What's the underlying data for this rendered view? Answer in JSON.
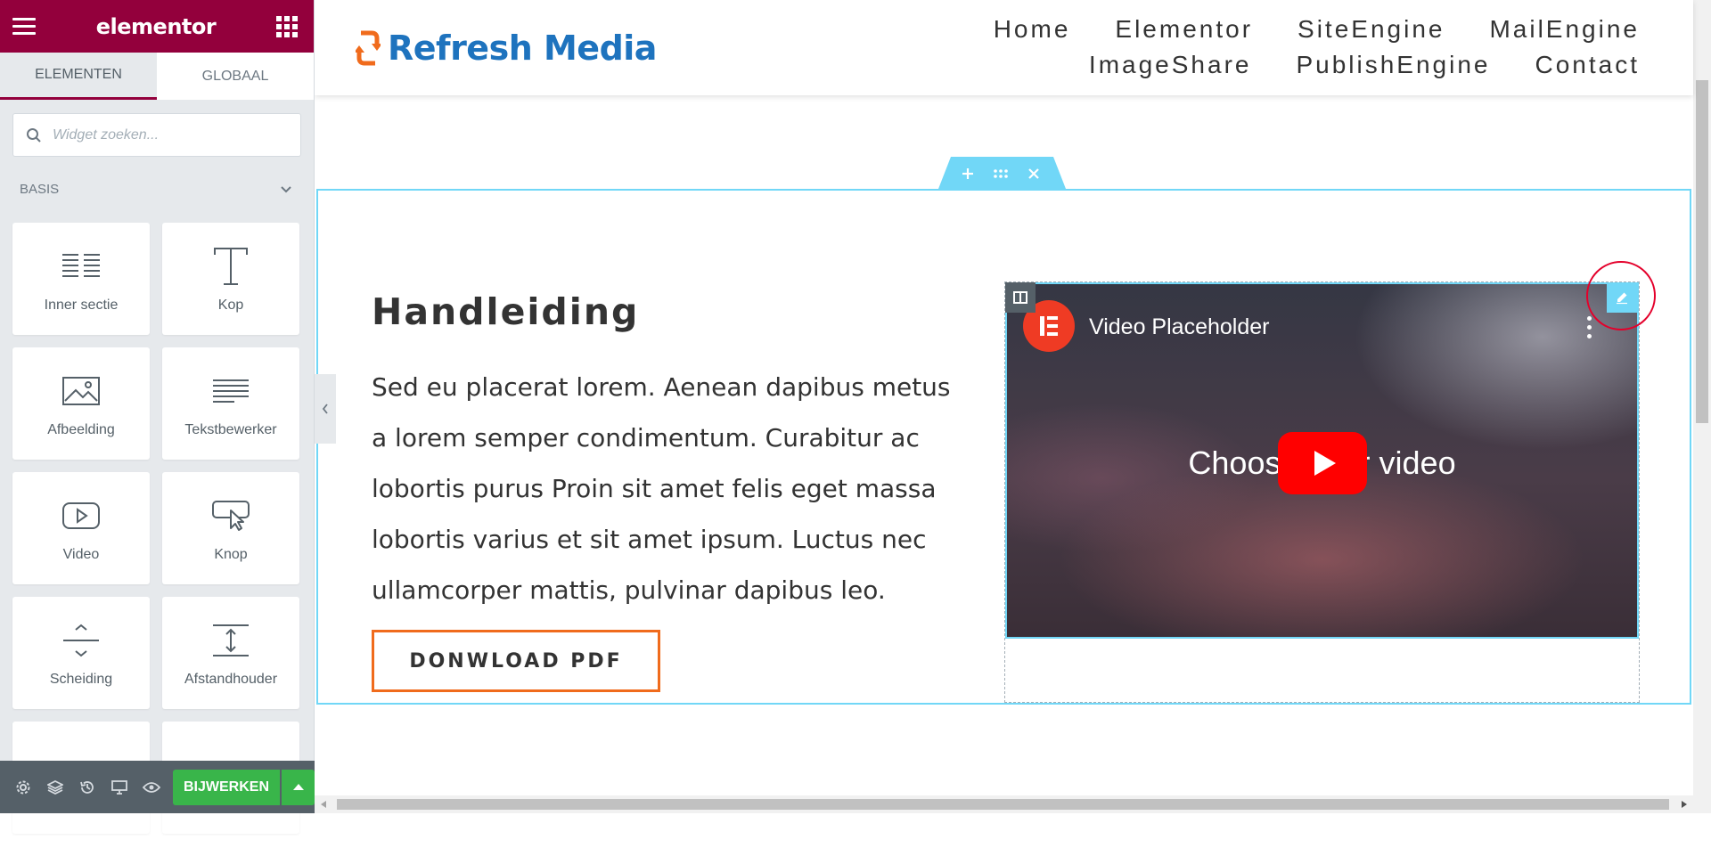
{
  "panel": {
    "logo": "elementor",
    "tabs": [
      "ELEMENTEN",
      "GLOBAAL"
    ],
    "search_placeholder": "Widget zoeken...",
    "category": "BASIS",
    "widgets": [
      {
        "label": "Inner sectie",
        "icon": "inner-section-icon"
      },
      {
        "label": "Kop",
        "icon": "heading-icon"
      },
      {
        "label": "Afbeelding",
        "icon": "image-icon"
      },
      {
        "label": "Tekstbewerker",
        "icon": "text-editor-icon"
      },
      {
        "label": "Video",
        "icon": "video-icon"
      },
      {
        "label": "Knop",
        "icon": "button-icon"
      },
      {
        "label": "Scheiding",
        "icon": "divider-icon"
      },
      {
        "label": "Afstandhouder",
        "icon": "spacer-icon"
      }
    ],
    "update_button": "BIJWERKEN"
  },
  "site": {
    "brand": "Refresh Media",
    "nav": [
      "Home",
      "Elementor",
      "SiteEngine",
      "MailEngine",
      "ImageShare",
      "PublishEngine",
      "Contact"
    ]
  },
  "content": {
    "heading": "Handleiding",
    "body": "Sed eu placerat lorem. Aenean dapibus metus a lorem semper condimentum. Curabitur ac lobortis purus Proin sit amet felis eget massa lobortis varius et sit amet ipsum. Luctus nec ullamcorper mattis, pulvinar dapibus leo.",
    "button": "DONWLOAD PDF",
    "video_title": "Video Placeholder",
    "video_caption": "Choose your video"
  },
  "colors": {
    "elementor_brand": "#93003c",
    "selection": "#71d7f7",
    "button_border": "#f06b1c",
    "update_green": "#39b54a"
  }
}
